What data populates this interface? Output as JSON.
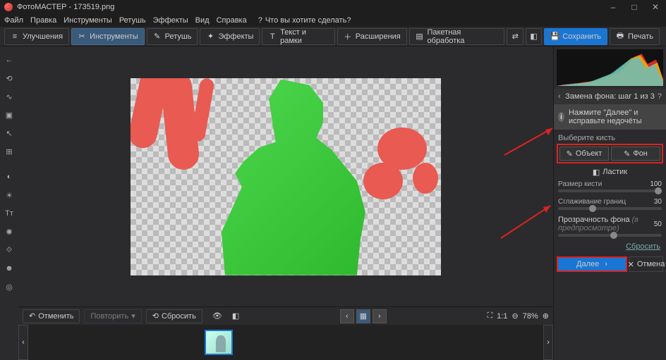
{
  "window": {
    "title": "ФотоМАСТЕР - 173519.png",
    "min": "–",
    "max": "□",
    "close": "✕"
  },
  "menu": {
    "items": [
      "Файл",
      "Правка",
      "Инструменты",
      "Ретушь",
      "Эффекты",
      "Вид",
      "Справка"
    ],
    "search_icon": "?",
    "search_placeholder": "Что вы хотите сделать?"
  },
  "toolbar": {
    "enhance": "Улучшения",
    "tools": "Инструменты",
    "retouch": "Ретушь",
    "effects": "Эффекты",
    "text": "Текст и рамки",
    "ext": "Расширения",
    "batch": "Пакетная обработка",
    "save": "Сохранить",
    "print": "Печать"
  },
  "bottom": {
    "undo": "Отменить",
    "redo": "Повторить",
    "reset": "Сбросить",
    "ratio": "1:1",
    "zoom": "78%"
  },
  "panel": {
    "step_title": "Замена фона: шаг 1 из 3",
    "hint": "Нажмите \"Далее\" и исправьте недочёты",
    "choose_brush": "Выберите кисть",
    "brush_object": "Объект",
    "brush_bg": "Фон",
    "brush_eraser": "Ластик",
    "size_label": "Размер кисти",
    "size_value": "100",
    "smooth_label": "Сглаживание границ",
    "smooth_value": "30",
    "opacity_label": "Прозрачность фона",
    "opacity_hint": "(в предпросмотре)",
    "opacity_value": "50",
    "reset": "Сбросить",
    "next": "Далее",
    "cancel": "Отмена"
  }
}
